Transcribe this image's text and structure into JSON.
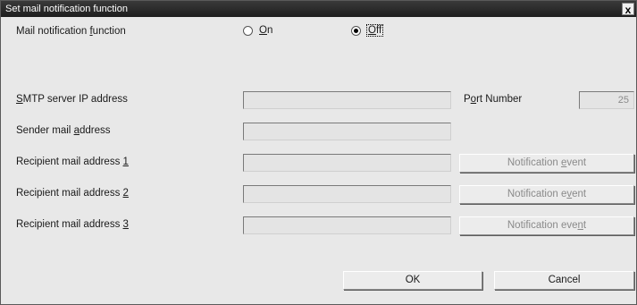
{
  "window": {
    "title": "Set mail notification function",
    "close_glyph": "x"
  },
  "notification": {
    "label_pre": "Mail notification ",
    "label_key": "f",
    "label_post": "unction",
    "options": [
      {
        "label_pre": "",
        "label_key": "O",
        "label_post": "n",
        "selected": false
      },
      {
        "label_pre": "",
        "label_key": "O",
        "label_post": "ff",
        "selected": true
      }
    ]
  },
  "smtp": {
    "label_pre": "",
    "label_key": "S",
    "label_post": "MTP server IP address",
    "value": ""
  },
  "port": {
    "label_pre": "P",
    "label_key": "o",
    "label_post": "rt Number",
    "value": "25"
  },
  "sender": {
    "label_pre": "Sender mail ",
    "label_key": "a",
    "label_post": "ddress",
    "value": ""
  },
  "recipients": [
    {
      "label_pre": "Recipient mail address ",
      "label_key": "1",
      "label_post": "",
      "value": "",
      "button": {
        "pre": "Notification ",
        "key": "e",
        "post": "vent"
      }
    },
    {
      "label_pre": "Recipient mail address ",
      "label_key": "2",
      "label_post": "",
      "value": "",
      "button": {
        "pre": "Notification e",
        "key": "v",
        "post": "ent"
      }
    },
    {
      "label_pre": "Recipient mail address ",
      "label_key": "3",
      "label_post": "",
      "value": "",
      "button": {
        "pre": "Notification eve",
        "key": "n",
        "post": "t"
      }
    }
  ],
  "actions": {
    "ok": "OK",
    "cancel": "Cancel"
  },
  "colors": {
    "titlebar": "#1e1e1e",
    "dialog_bg": "#e8e8e8",
    "disabled_text": "#8a8a8a"
  },
  "icons": {
    "close": "close-icon",
    "radio": "radio-icon"
  }
}
